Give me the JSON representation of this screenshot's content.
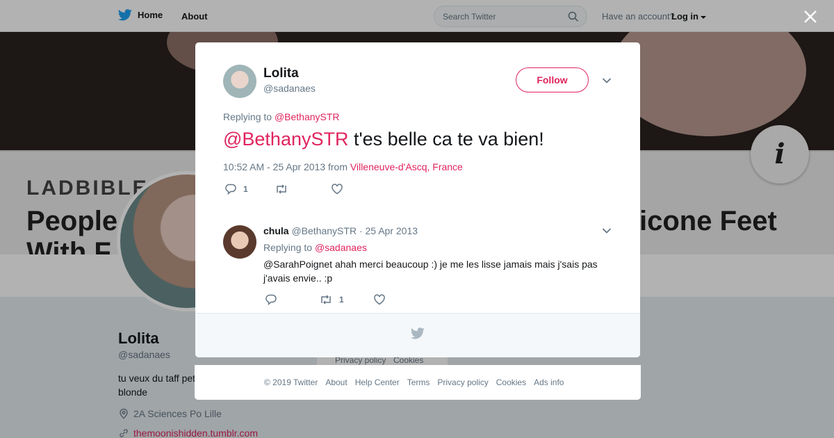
{
  "topbar": {
    "home_label": "Home",
    "about_label": "About",
    "search_placeholder": "Search Twitter",
    "have_account": "Have an account?",
    "login_label": "Log in"
  },
  "banner": {
    "brand": "LADBIBLE",
    "headline_left": "People",
    "headline_line2": "With F",
    "headline_right": "icone Feet",
    "info_glyph": "i"
  },
  "profile": {
    "name": "Lolita",
    "handle": "@sadanaes",
    "bio": "tu veux du taff pet blonde",
    "location": "2A Sciences Po Lille",
    "website": "themoonishidden.tumblr.com"
  },
  "bg_footer": {
    "privacy": "Privacy policy",
    "cookies": "Cookies"
  },
  "tweet": {
    "author_name": "Lolita",
    "author_handle": "@sadanaes",
    "follow_label": "Follow",
    "replying_to_label": "Replying to",
    "replying_to_handle": "@BethanySTR",
    "mention": "@BethanySTR",
    "text": " t'es belle ca te va bien!",
    "time": "10:52 AM - 25 Apr 2013",
    "from_label": "from",
    "place": "Villeneuve-d'Ascq, France",
    "reply_count": "1"
  },
  "reply": {
    "author_name": "chula",
    "author_handle": "@BethanySTR",
    "sep": " · ",
    "date": "25 Apr 2013",
    "replying_to_label": "Replying to",
    "replying_to_handle": "@sadanaes",
    "text": "@SarahPoignet ahah merci beaucoup :) je me les lisse jamais mais j'sais pas j'avais envie.. :p",
    "retweet_count": "1"
  },
  "footer": {
    "copyright": "© 2019 Twitter",
    "links": [
      "About",
      "Help Center",
      "Terms",
      "Privacy policy",
      "Cookies",
      "Ads info"
    ]
  },
  "colors": {
    "accent": "#e0245e",
    "twitter_blue": "#1da1f2",
    "muted": "#657786"
  }
}
